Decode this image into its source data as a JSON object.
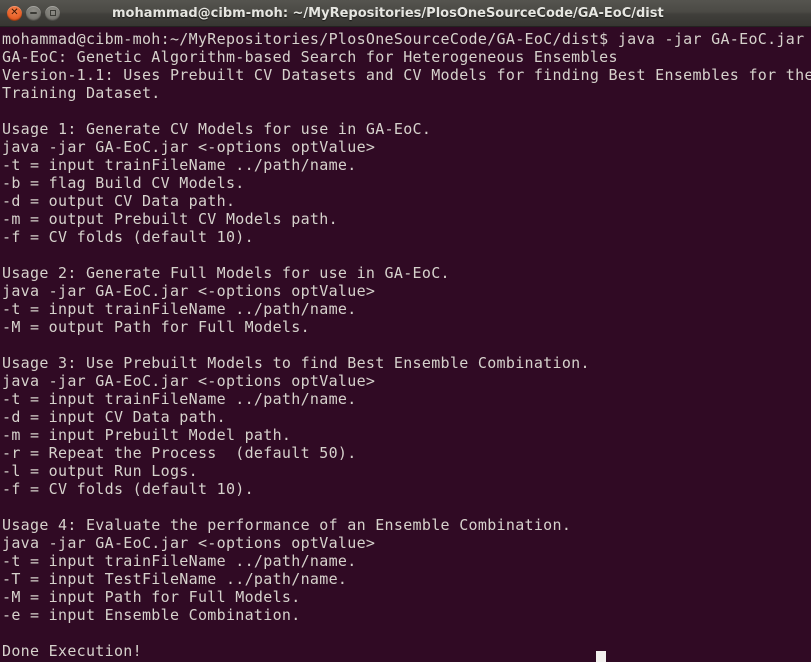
{
  "window": {
    "title": "mohammad@cibm-moh: ~/MyRepositories/PlosOneSourceCode/GA-EoC/dist",
    "buttons": {
      "close": "close-window",
      "minimize": "minimize-window",
      "maximize": "maximize-window"
    },
    "colors": {
      "titlebar_top": "#55544f",
      "titlebar_bottom": "#373632",
      "terminal_background": "#300a24",
      "terminal_foreground": "#d6d2cc",
      "close_button": "#e8622a",
      "cursor": "#f2f0ee"
    }
  },
  "terminal": {
    "prompt": "mohammad@cibm-moh:~/MyRepositories/PlosOneSourceCode/GA-EoC/dist$",
    "command": "java -jar GA-EoC.jar",
    "cursor_visible": true,
    "lines": [
      "mohammad@cibm-moh:~/MyRepositories/PlosOneSourceCode/GA-EoC/dist$ java -jar GA-EoC.jar",
      "GA-EoC: Genetic Algorithm-based Search for Heterogeneous Ensembles",
      "Version-1.1: Uses Prebuilt CV Datasets and CV Models for finding Best Ensembles for the",
      "Training Dataset.",
      "",
      "Usage 1: Generate CV Models for use in GA-EoC.",
      "java -jar GA-EoC.jar <-options optValue>",
      "-t = input trainFileName ../path/name.",
      "-b = flag Build CV Models.",
      "-d = output CV Data path.",
      "-m = output Prebuilt CV Models path.",
      "-f = CV folds (default 10).",
      "",
      "Usage 2: Generate Full Models for use in GA-EoC.",
      "java -jar GA-EoC.jar <-options optValue>",
      "-t = input trainFileName ../path/name.",
      "-M = output Path for Full Models.",
      "",
      "Usage 3: Use Prebuilt Models to find Best Ensemble Combination.",
      "java -jar GA-EoC.jar <-options optValue>",
      "-t = input trainFileName ../path/name.",
      "-d = input CV Data path.",
      "-m = input Prebuilt Model path.",
      "-r = Repeat the Process  (default 50).",
      "-l = output Run Logs.",
      "-f = CV folds (default 10).",
      "",
      "Usage 4: Evaluate the performance of an Ensemble Combination.",
      "java -jar GA-EoC.jar <-options optValue>",
      "-t = input trainFileName ../path/name.",
      "-T = input TestFileName ../path/name.",
      "-M = input Path for Full Models.",
      "-e = input Ensemble Combination.",
      "",
      "Done Execution!"
    ]
  }
}
